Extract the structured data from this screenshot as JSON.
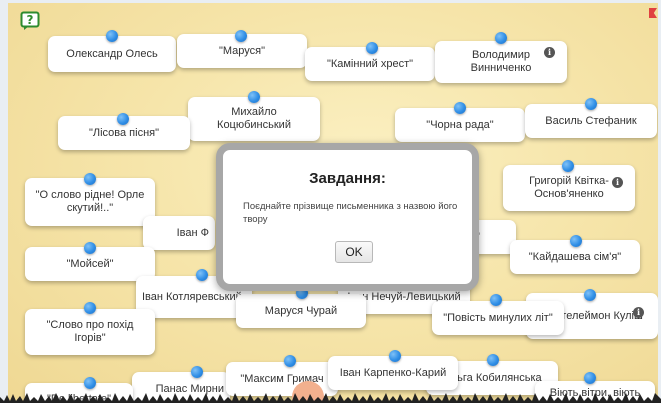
{
  "game": {
    "cards": [
      {
        "id": "oles",
        "label": "Олександр Олесь"
      },
      {
        "id": "marusia",
        "label": "\"Маруся\""
      },
      {
        "id": "kaminnyi",
        "label": "\"Камінний хрест\""
      },
      {
        "id": "vynnychenko",
        "label": "Володимир Винниченко"
      },
      {
        "id": "kotsiubynskyi",
        "label": "Михайло Коцюбинський"
      },
      {
        "id": "lisova",
        "label": "\"Лісова пісня\""
      },
      {
        "id": "chorna",
        "label": "\"Чорна рада\""
      },
      {
        "id": "stefanyk",
        "label": "Василь Стефаник"
      },
      {
        "id": "o_slovo",
        "label": "\"О слово рідне! Орле скутий!..\""
      },
      {
        "id": "kvitka",
        "label": "Григорій Квітка-Основ'яненко"
      },
      {
        "id": "ivan_f",
        "label": "Іван Ф"
      },
      {
        "id": "r_partial",
        "label": "\""
      },
      {
        "id": "kaidasheva",
        "label": "\"Кайдашева сім'я\""
      },
      {
        "id": "moisei",
        "label": "\"Мойсей\""
      },
      {
        "id": "kotliarevskyi",
        "label": "Іван Котляревський"
      },
      {
        "id": "nechui",
        "label": "Іван Нечуй-Левицький"
      },
      {
        "id": "churai",
        "label": "Маруся Чурай"
      },
      {
        "id": "povist",
        "label": "\"Повість минулих літ\""
      },
      {
        "id": "kulish",
        "label": "Пантелеймон Куліш"
      },
      {
        "id": "slovo_pokhid",
        "label": "\"Слово про похід Ігорів\""
      },
      {
        "id": "myrnyi",
        "label": "Панас Мирни"
      },
      {
        "id": "hrymach",
        "label": "\"Максим Гримач"
      },
      {
        "id": "karpenko",
        "label": "Іван Карпенко-Карий"
      },
      {
        "id": "kobylianska",
        "label": "Ольга Кобилянська"
      },
      {
        "id": "de_libertate",
        "label": "\"De libertate\""
      },
      {
        "id": "viiut_vitry",
        "label": "Віють вітри, віють"
      }
    ],
    "modal": {
      "title": "Завдання:",
      "text": "Поєднайте прізвище письменника з назвою його твору",
      "ok_label": "OK"
    }
  }
}
